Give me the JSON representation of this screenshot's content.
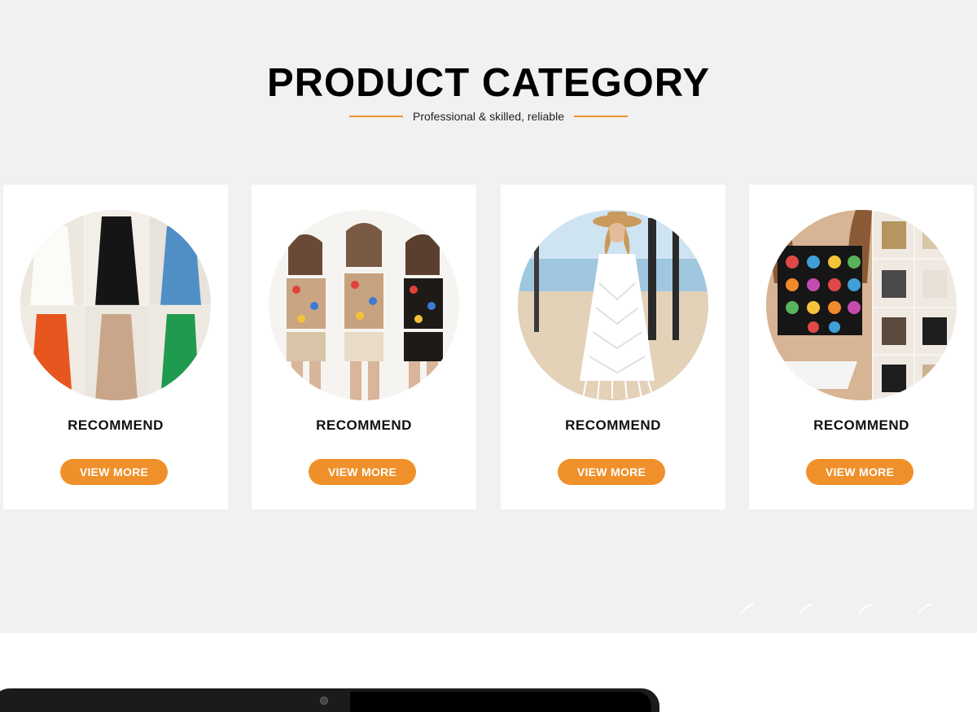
{
  "header": {
    "title": "PRODUCT CATEGORY",
    "subtitle": "Professional & skilled, reliable"
  },
  "categories": [
    {
      "label": "RECOMMEND",
      "button": "VIEW MORE",
      "image": "crochet-fringe-dresses-collage"
    },
    {
      "label": "RECOMMEND",
      "button": "VIEW MORE",
      "image": "granny-square-crop-tops-models"
    },
    {
      "label": "RECOMMEND",
      "button": "VIEW MORE",
      "image": "white-crochet-beach-dress"
    },
    {
      "label": "RECOMMEND",
      "button": "VIEW MORE",
      "image": "black-granny-square-crop-top-collage"
    }
  ],
  "colors": {
    "accent": "#f0902a",
    "background": "#f1f1f1",
    "card": "#ffffff"
  }
}
